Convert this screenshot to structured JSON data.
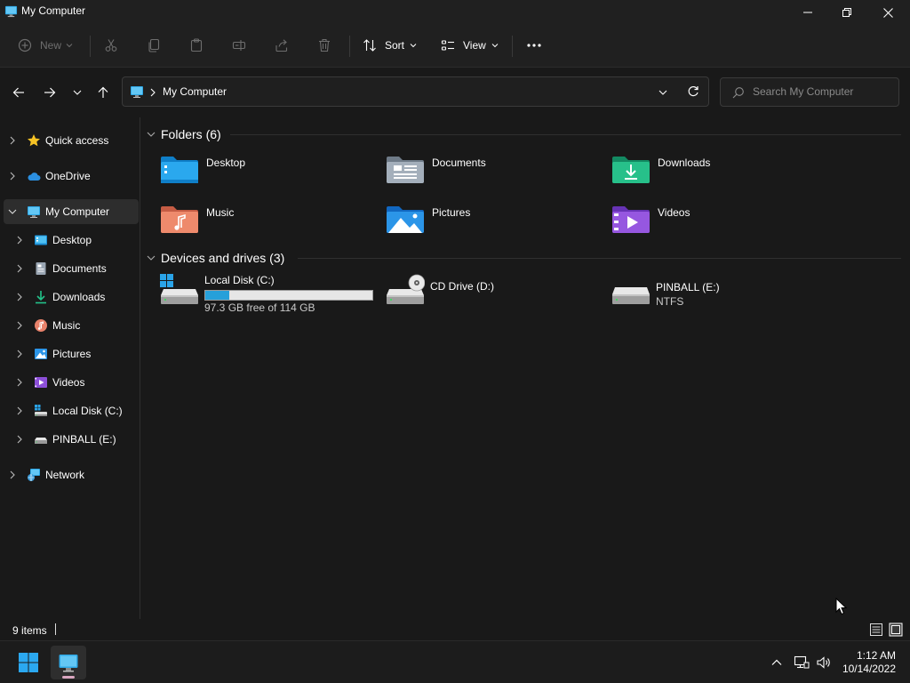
{
  "window": {
    "title": "My Computer",
    "minimize_icon": "minimize-icon",
    "restore_icon": "restore-icon",
    "close_icon": "close-icon"
  },
  "commandbar": {
    "new_label": "New",
    "sort_label": "Sort",
    "view_label": "View",
    "icons": [
      "plus-circle-icon",
      "cut-icon",
      "copy-icon",
      "paste-icon",
      "rename-icon",
      "share-icon",
      "delete-icon",
      "sort-icon",
      "view-icon",
      "more-icon"
    ]
  },
  "address": {
    "location": "My Computer",
    "search_placeholder": "Search My Computer"
  },
  "sidebar": {
    "items": [
      {
        "label": "Quick access",
        "icon": "star-icon"
      },
      {
        "label": "OneDrive",
        "icon": "cloud-icon"
      },
      {
        "label": "My Computer",
        "icon": "computer-icon",
        "selected": true
      },
      {
        "label": "Desktop",
        "icon": "desktop-icon"
      },
      {
        "label": "Documents",
        "icon": "documents-icon"
      },
      {
        "label": "Downloads",
        "icon": "downloads-icon"
      },
      {
        "label": "Music",
        "icon": "music-icon"
      },
      {
        "label": "Pictures",
        "icon": "pictures-icon"
      },
      {
        "label": "Videos",
        "icon": "videos-icon"
      },
      {
        "label": "Local Disk (C:)",
        "icon": "local-disk-icon"
      },
      {
        "label": "PINBALL (E:)",
        "icon": "drive-icon"
      },
      {
        "label": "Network",
        "icon": "network-icon"
      }
    ]
  },
  "main": {
    "folders_heading": "Folders (6)",
    "folders": [
      {
        "label": "Desktop",
        "icon": "desktop-folder-icon"
      },
      {
        "label": "Documents",
        "icon": "documents-folder-icon"
      },
      {
        "label": "Downloads",
        "icon": "downloads-folder-icon"
      },
      {
        "label": "Music",
        "icon": "music-folder-icon"
      },
      {
        "label": "Pictures",
        "icon": "pictures-folder-icon"
      },
      {
        "label": "Videos",
        "icon": "videos-folder-icon"
      }
    ],
    "drives_heading": "Devices and drives (3)",
    "drives": [
      {
        "label": "Local Disk (C:)",
        "sub": "97.3 GB free of 114 GB",
        "used_fraction": 0.146,
        "icon": "local-disk-icon"
      },
      {
        "label": "CD Drive (D:)",
        "sub": "",
        "icon": "cd-drive-icon"
      },
      {
        "label": "PINBALL (E:)",
        "sub": "NTFS",
        "icon": "drive-icon"
      }
    ]
  },
  "status": {
    "count": "9 items"
  },
  "taskbar": {
    "time": "1:12 AM",
    "date": "10/14/2022"
  },
  "colors": {
    "background": "#191919",
    "chrome": "#202020",
    "accent": "#26a0da",
    "selection": "#2d2d2d"
  }
}
